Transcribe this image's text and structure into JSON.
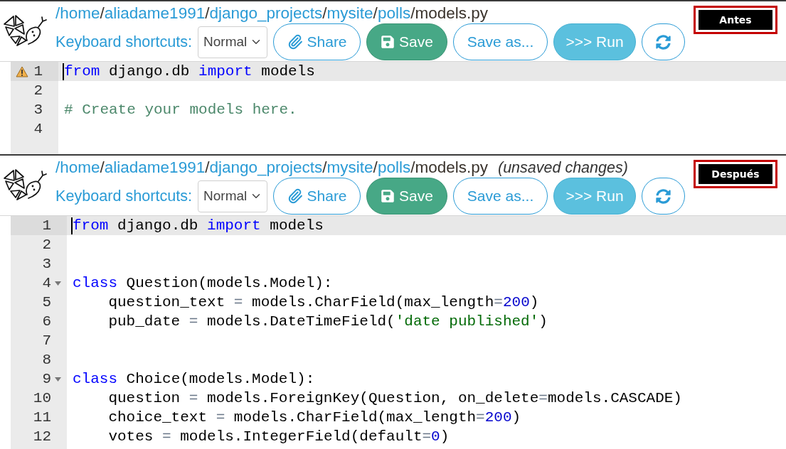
{
  "panels": [
    {
      "path": [
        {
          "kind": "link",
          "text": "/home"
        },
        {
          "kind": "separator",
          "text": "/"
        },
        {
          "kind": "link",
          "text": "aliadame1991"
        },
        {
          "kind": "separator",
          "text": "/"
        },
        {
          "kind": "link",
          "text": "django_projects"
        },
        {
          "kind": "separator",
          "text": "/"
        },
        {
          "kind": "link",
          "text": "mysite"
        },
        {
          "kind": "separator",
          "text": "/"
        },
        {
          "kind": "link",
          "text": "polls"
        },
        {
          "kind": "separator",
          "text": "/"
        },
        {
          "kind": "file",
          "text": "models.py"
        }
      ],
      "shortcuts": {
        "label": "Keyboard shortcuts:",
        "value": "Normal"
      },
      "buttons": [
        {
          "kind": "share",
          "label": "Share"
        },
        {
          "kind": "save",
          "label": "Save"
        },
        {
          "kind": "save_as",
          "label": "Save as..."
        },
        {
          "kind": "run",
          "label": ">>> Run"
        },
        {
          "kind": "reload"
        }
      ],
      "badge": "Antes",
      "lines": [
        {
          "number": "1",
          "active": true,
          "warning": true,
          "tokens": [
            {
              "kind": "keyword",
              "text": "from"
            },
            {
              "kind": "plain",
              "text": " django.db "
            },
            {
              "kind": "keyword",
              "text": "import"
            },
            {
              "kind": "plain",
              "text": " models"
            }
          ]
        },
        {
          "number": "2",
          "active": false,
          "warning": false
        },
        {
          "number": "3",
          "active": false,
          "warning": false,
          "tokens": [
            {
              "kind": "comment",
              "text": "# Create your models here."
            }
          ]
        },
        {
          "number": "4",
          "active": false,
          "warning": false
        }
      ]
    },
    {
      "path": [
        {
          "kind": "link",
          "text": "/home"
        },
        {
          "kind": "separator",
          "text": "/"
        },
        {
          "kind": "link",
          "text": "aliadame1991"
        },
        {
          "kind": "separator",
          "text": "/"
        },
        {
          "kind": "link",
          "text": "django_projects"
        },
        {
          "kind": "separator",
          "text": "/"
        },
        {
          "kind": "link",
          "text": "mysite"
        },
        {
          "kind": "separator",
          "text": "/"
        },
        {
          "kind": "link",
          "text": "polls"
        },
        {
          "kind": "separator",
          "text": "/"
        },
        {
          "kind": "file",
          "text": "models.py"
        }
      ],
      "status": "(unsaved changes)",
      "shortcuts": {
        "label": "Keyboard shortcuts:",
        "value": "Normal"
      },
      "buttons": [
        {
          "kind": "share",
          "label": "Share"
        },
        {
          "kind": "save",
          "label": "Save"
        },
        {
          "kind": "save_as",
          "label": "Save as..."
        },
        {
          "kind": "run",
          "label": ">>> Run"
        },
        {
          "kind": "reload"
        }
      ],
      "badge": "Después",
      "lines": [
        {
          "number": "1",
          "active": true,
          "foldable": false,
          "tokens": [
            {
              "kind": "keyword",
              "text": "from"
            },
            {
              "kind": "plain",
              "text": " django.db "
            },
            {
              "kind": "keyword",
              "text": "import"
            },
            {
              "kind": "plain",
              "text": " models"
            }
          ]
        },
        {
          "number": "2",
          "active": false,
          "foldable": false
        },
        {
          "number": "3",
          "active": false,
          "foldable": false
        },
        {
          "number": "4",
          "active": false,
          "foldable": true,
          "tokens": [
            {
              "kind": "keyword",
              "text": "class"
            },
            {
              "kind": "plain",
              "text": " Question(models.Model):"
            }
          ]
        },
        {
          "number": "5",
          "active": false,
          "foldable": false,
          "tokens": [
            {
              "kind": "plain",
              "text": "    question_text "
            },
            {
              "kind": "operator",
              "text": "="
            },
            {
              "kind": "plain",
              "text": " models.CharField(max_length"
            },
            {
              "kind": "operator",
              "text": "="
            },
            {
              "kind": "number",
              "text": "200"
            },
            {
              "kind": "plain",
              "text": ")"
            }
          ]
        },
        {
          "number": "6",
          "active": false,
          "foldable": false,
          "tokens": [
            {
              "kind": "plain",
              "text": "    pub_date "
            },
            {
              "kind": "operator",
              "text": "="
            },
            {
              "kind": "plain",
              "text": " models.DateTimeField("
            },
            {
              "kind": "string",
              "text": "'date published'"
            },
            {
              "kind": "plain",
              "text": ")"
            }
          ]
        },
        {
          "number": "7",
          "active": false,
          "foldable": false
        },
        {
          "number": "8",
          "active": false,
          "foldable": false
        },
        {
          "number": "9",
          "active": false,
          "foldable": true,
          "tokens": [
            {
              "kind": "keyword",
              "text": "class"
            },
            {
              "kind": "plain",
              "text": " Choice(models.Model):"
            }
          ]
        },
        {
          "number": "10",
          "active": false,
          "foldable": false,
          "tokens": [
            {
              "kind": "plain",
              "text": "    question "
            },
            {
              "kind": "operator",
              "text": "="
            },
            {
              "kind": "plain",
              "text": " models.ForeignKey(Question, on_delete"
            },
            {
              "kind": "operator",
              "text": "="
            },
            {
              "kind": "plain",
              "text": "models.CASCADE)"
            }
          ]
        },
        {
          "number": "11",
          "active": false,
          "foldable": false,
          "tokens": [
            {
              "kind": "plain",
              "text": "    choice_text "
            },
            {
              "kind": "operator",
              "text": "="
            },
            {
              "kind": "plain",
              "text": " models.CharField(max_length"
            },
            {
              "kind": "operator",
              "text": "="
            },
            {
              "kind": "number",
              "text": "200"
            },
            {
              "kind": "plain",
              "text": ")"
            }
          ]
        },
        {
          "number": "12",
          "active": false,
          "foldable": false,
          "tokens": [
            {
              "kind": "plain",
              "text": "    votes "
            },
            {
              "kind": "operator",
              "text": "="
            },
            {
              "kind": "plain",
              "text": " models.IntegerField(default"
            },
            {
              "kind": "operator",
              "text": "="
            },
            {
              "kind": "number",
              "text": "0"
            },
            {
              "kind": "plain",
              "text": ")"
            }
          ]
        }
      ]
    }
  ]
}
